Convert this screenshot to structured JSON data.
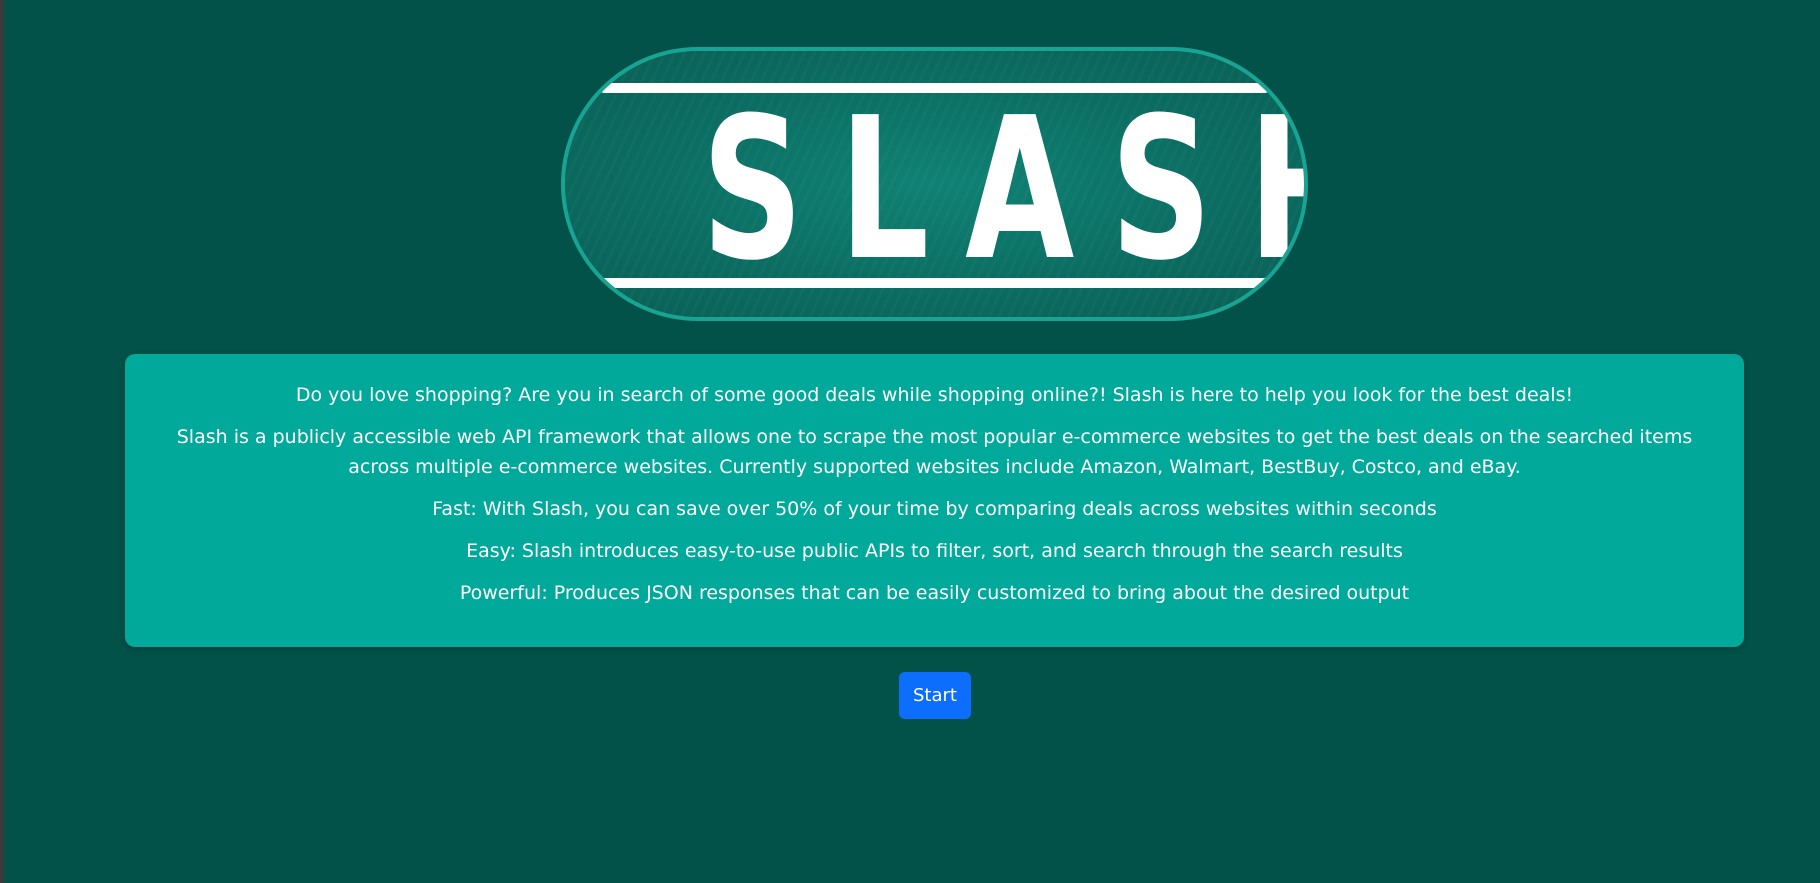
{
  "logo": {
    "text": "SLASH"
  },
  "intro": {
    "paragraphs": [
      "Do you love shopping? Are you in search of some good deals while shopping online?! Slash is here to help you look for the best deals!",
      "Slash is a publicly accessible web API framework that allows one to scrape the most popular e-commerce websites to get the best deals on the searched items across multiple e-commerce websites. Currently supported websites include Amazon, Walmart, BestBuy, Costco, and eBay.",
      "Fast: With Slash, you can save over 50% of your time by comparing deals across websites within seconds",
      "Easy: Slash introduces easy-to-use public APIs to filter, sort, and search through the search results",
      "Powerful: Produces JSON responses that can be easily customized to bring about the desired output"
    ]
  },
  "start_button": {
    "label": "Start"
  },
  "colors": {
    "background": "#025249",
    "panel": "#00a99a",
    "button": "#0d6efd",
    "logo_border": "#17a493"
  }
}
